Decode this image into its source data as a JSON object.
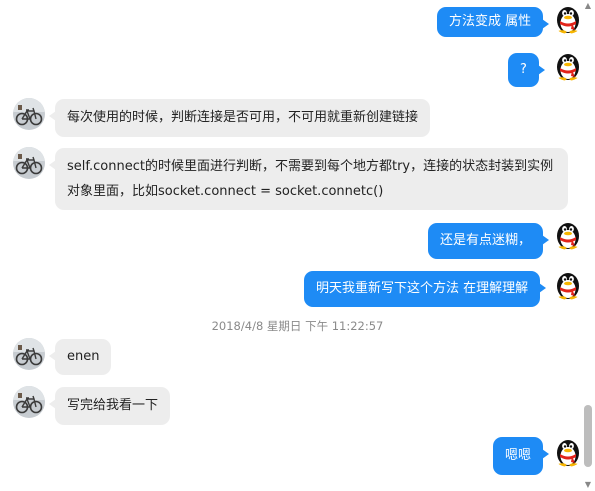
{
  "messages": [
    {
      "side": "out",
      "text": "方法变成 属性"
    },
    {
      "side": "out",
      "text": "?"
    },
    {
      "side": "in",
      "text": "每次使用的时候，判断连接是否可用，不可用就重新创建链接"
    },
    {
      "side": "in",
      "line1": "self.connect的时候里面进行判断，不需要到每个地方都try，连接的状态封装到实例",
      "line2": "对象里面，比如socket.connect = socket.connetc()"
    },
    {
      "side": "out",
      "text": "还是有点迷糊，"
    },
    {
      "side": "out",
      "text": "明天我重新写下这个方法  在理解理解"
    },
    {
      "side": "in",
      "text": "enen"
    },
    {
      "side": "in",
      "text": "写完给我看一下"
    },
    {
      "side": "out",
      "text": "嗯嗯"
    }
  ],
  "timestamp": "2018/4/8 星期日 下午 11:22:57",
  "scrollbar": {
    "up_arrow": "▲",
    "down_arrow": "▼"
  },
  "avatars": {
    "me": "qq-penguin-icon",
    "contact": "bicycle-photo-avatar"
  },
  "colors": {
    "outgoing_bubble": "#1e8bf5",
    "incoming_bubble": "#ededed",
    "timestamp": "#8a8a8a"
  }
}
